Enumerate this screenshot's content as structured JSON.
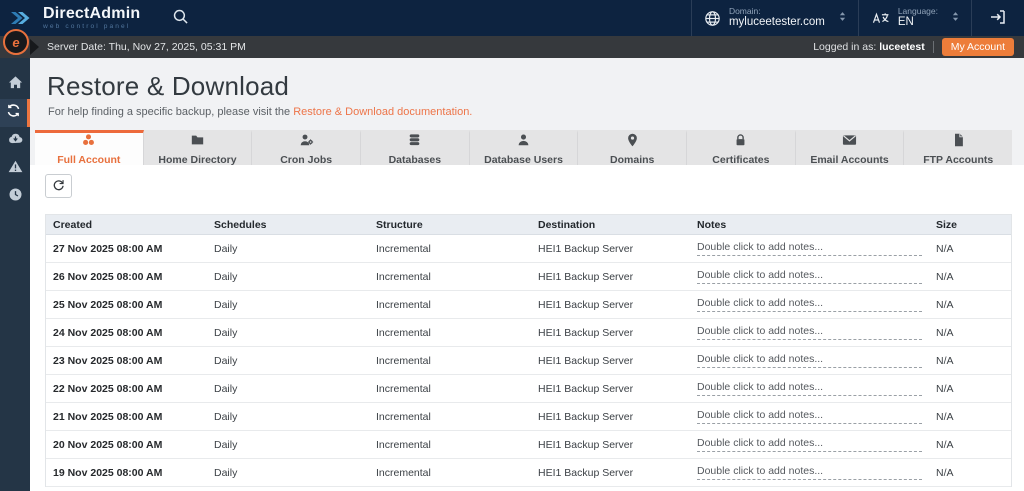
{
  "colors": {
    "accent": "#e8703d",
    "button_orange": "#ed7d3a",
    "header_navy": "#0d2340",
    "infobar_dark": "#36393d",
    "sidebar_navy": "#243546"
  },
  "header": {
    "brand": {
      "name": "DirectAdmin",
      "tagline": "web control panel",
      "logo_icon": "double-chevron-icon"
    },
    "search_icon": "search-icon",
    "domain": {
      "label": "Domain:",
      "value": "myluceetester.com",
      "icon": "globe-icon"
    },
    "language": {
      "label": "Language:",
      "value": "EN",
      "icon": "translate-icon"
    },
    "logout_icon": "logout-icon"
  },
  "infobar": {
    "avatar_icon": "user-avatar",
    "server_date": "Server Date: Thu, Nov 27, 2025, 05:31 PM",
    "logged_in_prefix": "Logged in as: ",
    "username": "luceetest",
    "my_account_label": "My Account"
  },
  "sidebar": {
    "items": [
      {
        "name": "home",
        "icon": "home-icon",
        "active": false
      },
      {
        "name": "restore",
        "icon": "sync-icon",
        "active": true
      },
      {
        "name": "backups",
        "icon": "cloud-download-icon",
        "active": false
      },
      {
        "name": "alerts",
        "icon": "warning-icon",
        "active": false
      },
      {
        "name": "history",
        "icon": "clock-icon",
        "active": false
      }
    ]
  },
  "page": {
    "title": "Restore & Download",
    "help_text": "For help finding a specific backup, please visit the ",
    "help_link": "Restore & Download documentation."
  },
  "tabs": [
    {
      "label": "Full Account",
      "icon": "cluster-icon",
      "active": true
    },
    {
      "label": "Home Directory",
      "icon": "folder-icon",
      "active": false
    },
    {
      "label": "Cron Jobs",
      "icon": "user-gear-icon",
      "active": false
    },
    {
      "label": "Databases",
      "icon": "database-icon",
      "active": false
    },
    {
      "label": "Database Users",
      "icon": "user-icon",
      "active": false
    },
    {
      "label": "Domains",
      "icon": "map-pin-icon",
      "active": false
    },
    {
      "label": "Certificates",
      "icon": "lock-icon",
      "active": false
    },
    {
      "label": "Email Accounts",
      "icon": "envelope-icon",
      "active": false
    },
    {
      "label": "FTP Accounts",
      "icon": "file-icon",
      "active": false
    }
  ],
  "toolbar": {
    "refresh_icon": "refresh-icon"
  },
  "table": {
    "columns": [
      "Created",
      "Schedules",
      "Structure",
      "Destination",
      "Notes",
      "Size"
    ],
    "notes_placeholder": "Double click to add notes...",
    "rows": [
      {
        "created": "27 Nov 2025 08:00 AM",
        "schedules": "Daily",
        "structure": "Incremental",
        "destination": "HEI1 Backup Server",
        "notes": "Double click to add notes...",
        "size": "N/A"
      },
      {
        "created": "26 Nov 2025 08:00 AM",
        "schedules": "Daily",
        "structure": "Incremental",
        "destination": "HEI1 Backup Server",
        "notes": "Double click to add notes...",
        "size": "N/A"
      },
      {
        "created": "25 Nov 2025 08:00 AM",
        "schedules": "Daily",
        "structure": "Incremental",
        "destination": "HEI1 Backup Server",
        "notes": "Double click to add notes...",
        "size": "N/A"
      },
      {
        "created": "24 Nov 2025 08:00 AM",
        "schedules": "Daily",
        "structure": "Incremental",
        "destination": "HEI1 Backup Server",
        "notes": "Double click to add notes...",
        "size": "N/A"
      },
      {
        "created": "23 Nov 2025 08:00 AM",
        "schedules": "Daily",
        "structure": "Incremental",
        "destination": "HEI1 Backup Server",
        "notes": "Double click to add notes...",
        "size": "N/A"
      },
      {
        "created": "22 Nov 2025 08:00 AM",
        "schedules": "Daily",
        "structure": "Incremental",
        "destination": "HEI1 Backup Server",
        "notes": "Double click to add notes...",
        "size": "N/A"
      },
      {
        "created": "21 Nov 2025 08:00 AM",
        "schedules": "Daily",
        "structure": "Incremental",
        "destination": "HEI1 Backup Server",
        "notes": "Double click to add notes...",
        "size": "N/A"
      },
      {
        "created": "20 Nov 2025 08:00 AM",
        "schedules": "Daily",
        "structure": "Incremental",
        "destination": "HEI1 Backup Server",
        "notes": "Double click to add notes...",
        "size": "N/A"
      },
      {
        "created": "19 Nov 2025 08:00 AM",
        "schedules": "Daily",
        "structure": "Incremental",
        "destination": "HEI1 Backup Server",
        "notes": "Double click to add notes...",
        "size": "N/A"
      }
    ]
  }
}
